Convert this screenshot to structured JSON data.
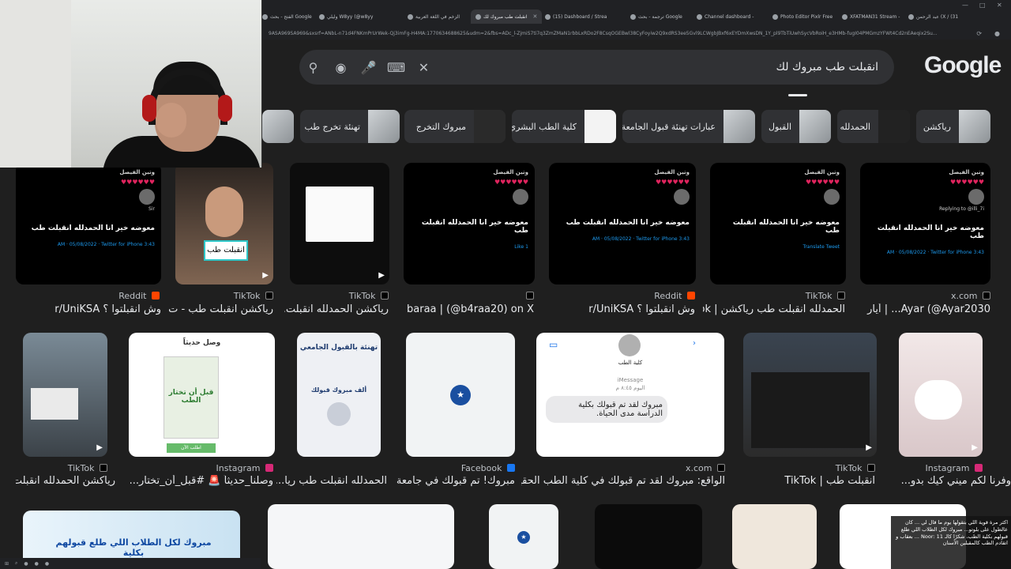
{
  "browser": {
    "tabs": [
      {
        "label": "الفتح - بحث Google",
        "active": false
      },
      {
        "label": "وليلي W8yy (@w8yy",
        "active": false
      },
      {
        "label": "الزخم في اللغة العربية",
        "active": false
      },
      {
        "label": "انقبلت طب مبروك لك",
        "active": true
      },
      {
        "label": "(15) Dashboard / Strea",
        "active": false
      },
      {
        "label": "ترجمة - بحث Google",
        "active": false
      },
      {
        "label": "Channel dashboard -",
        "active": false
      },
      {
        "label": "Photo Editor Pixlr Free",
        "active": false
      },
      {
        "label": "XFATMAN31 Stream -",
        "active": false
      },
      {
        "label": "عبد الرحمن (X / (31",
        "active": false
      }
    ],
    "url": "9ASA969SA969&sxsrf=ANbL-n71d4FNKmPrUrWek-Qj3imFg-H4MA:1770634688625&udm=2&fbs=ADc_l-ZjmiS7ti7q3ZmZMaN1rbbLxRDo2F8CsqOGEBwl38CyFoyiw2Q9xdRS3ee5Gvl9LCWgbJBxf6xEYDmXwsDN_1Y_pl9TbTiUwhSycVbRoiH_e3HMb-fugI04PMGmzYFWt4Cd2nEAeqix2Su..."
  },
  "search": {
    "query": "انقبلت طب مبروك لك",
    "logo_text": "Google",
    "icons": [
      "search-icon",
      "lens-icon",
      "mic-icon",
      "keyboard-icon",
      "clear-icon"
    ]
  },
  "chips": [
    {
      "label": "رياكشن"
    },
    {
      "label": "الحمدلله"
    },
    {
      "label": "القبول"
    },
    {
      "label": "عبارات تهنئة قبول الجامعة"
    },
    {
      "label": "كلية الطب البشري"
    },
    {
      "label": "مبروك التخرج"
    },
    {
      "label": "تهنئة تخرج طب"
    }
  ],
  "row1": [
    {
      "source": "x.com",
      "title": "Ayar (@Ayar2030... | أيار",
      "tweet": "معوضه خير انا الحمدلله انقبلت طب"
    },
    {
      "source": "TikTok",
      "title": "الحمدلله انقبلت طب رياكشن | ok..."
    },
    {
      "source": "Reddit",
      "title": "وش انقبلتوا ؟ r/UniKSA"
    },
    {
      "source": "",
      "title": "baraa | (@b4raa20) on X"
    },
    {
      "source": "TikTok",
      "title": "رياكشن الحمدلله انقبلت..."
    },
    {
      "source": "TikTok",
      "title": "رياكشن انقبلت طب - ت..."
    },
    {
      "source": "Reddit",
      "title": "وش انقبلتوا ؟ r/UniKSA"
    }
  ],
  "row2": [
    {
      "source": "Instagram",
      "title": "وفرنا لكم ميني كيك بدو..."
    },
    {
      "source": "TikTok",
      "title": "انقبلت طب | TikTok"
    },
    {
      "source": "x.com",
      "title": "الواقع: مبروك لقد تم قبولك في كلية الطب الحقيقة:"
    },
    {
      "source": "Facebook",
      "title": "مبروك! تم قبولك في جامعة ..."
    },
    {
      "source": "",
      "title": "الحمدلله انقبلت طب ريا..."
    },
    {
      "source": "Instagram",
      "title": "وصلنا_حديثاً 🚨 #قبل_أن_تختار..."
    },
    {
      "source": "TikTok",
      "title": "رياكشن الحمدلله انقبلت..."
    }
  ],
  "imessage": {
    "header": "كلية الطب",
    "service": "iMessage",
    "time": "اليوم ٨:٤٥ م",
    "text": "مبروك لقد تم قبولك بكلية الدراسة مدى الحياة."
  },
  "tiktok_caption": "انقبلت طب",
  "tweet_meta": {
    "name": "وتين الفيصل",
    "reply": "Replying to @illi_7i",
    "user": "Sir",
    "time": "3:43 AM · 05/08/2022 · Twitter for iPhone",
    "translate": "Translate Tweet",
    "likes": "1 Like"
  },
  "book": {
    "title": "قبل أن تختار الطب",
    "tag": "وصل حديثاً",
    "cta": "اطلب الآن"
  },
  "card_congrats": {
    "title": "تهنئة بالقبول الجامعي",
    "line": "ألف مبروك قبولك"
  },
  "row3_text": "مبروك لكل الطلاب اللي طلع قبولهم بكلية",
  "note": "اكثر مرة قوية اللي بتقولها يوم ما قال لي ... كان عالطول على بلوتو... مبروك لكل الطلاب اللي طلع قبولهم بكلية الطب، شكرًا كالـ Noor: 11 ... بعقاب و اتقادم الطب كالمقبلين الأسنان",
  "colors": {
    "bg": "#1f1f1f",
    "search": "#303134",
    "text": "#e8eaed",
    "muted": "#bdc1c6"
  }
}
